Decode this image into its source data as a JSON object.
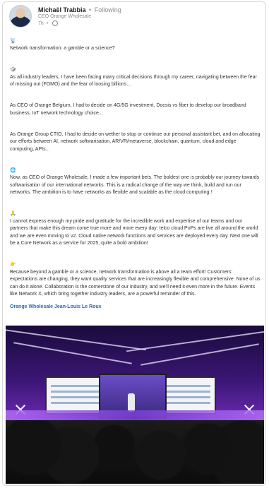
{
  "post": {
    "author": {
      "name": "Michaël Trabbia",
      "connection": "Following",
      "headline": "CEO Orange Wholesale",
      "time": "7h"
    },
    "paragraphs": [
      {
        "emoji": "📡",
        "text": "Network transformation: a gamble or a science?"
      },
      {
        "emoji": "🎲",
        "text": "As all industry leaders, I have been facing many critical decisions through my career, navigating between the fear of missing out (FOMO) and the fear of loosing billions..."
      },
      {
        "emoji": "",
        "text": "As CEO of Orange Belgium, I had to decide on 4G/5G investment, Docsis vs fiber to develop our broadband business, IoT network technology choice..."
      },
      {
        "emoji": "",
        "text": "As Orange Group CTIO, I had to decide on wether to stop or continue our personal assistant bet, and on allocating our efforts between AI, network softwarisation, AR/VR/metaverse, blockchain, quantum, cloud and edge computing, APIs..."
      },
      {
        "emoji": "🌐",
        "text": "Now, as CEO of Orange Wholesale, I made a few important bets. The boldest one is probably our journey towards softwarisation of our international networks. This is a radical change of the way we think, build and run our networks. The ambition is to have networks as flexible and scalable as the cloud computing !"
      },
      {
        "emoji": "🙏",
        "text": "I cannot express enough my pride and gratitude for the incredible work and expertise of our teams and our partners that make this dream come true more and more every day: telco cloud PoPs are live all around the world and we are even moving to v2. Cloud native network functions and services are deployed every day. Next one will be a Core Network as a service for 2025, quite a bold ambition!"
      },
      {
        "emoji": "👉",
        "text": "Because beyond a gamble or a science, network transformation is above all a team effort! Customers' expectations are changing, they want quality services that are increasingly flexible and comprehensive. None of us can do it alone. Collaboration is the cornerstone of our industry, and we'll need it even more in the future. Events like Network X, which bring together industry leaders, are a powerful reminder of this."
      }
    ],
    "tags": "Orange Wholesale  Jean-Louis Le Roux"
  },
  "colors": {
    "link": "#2d66b3",
    "text": "#333333",
    "meta": "#8a8a8a"
  }
}
